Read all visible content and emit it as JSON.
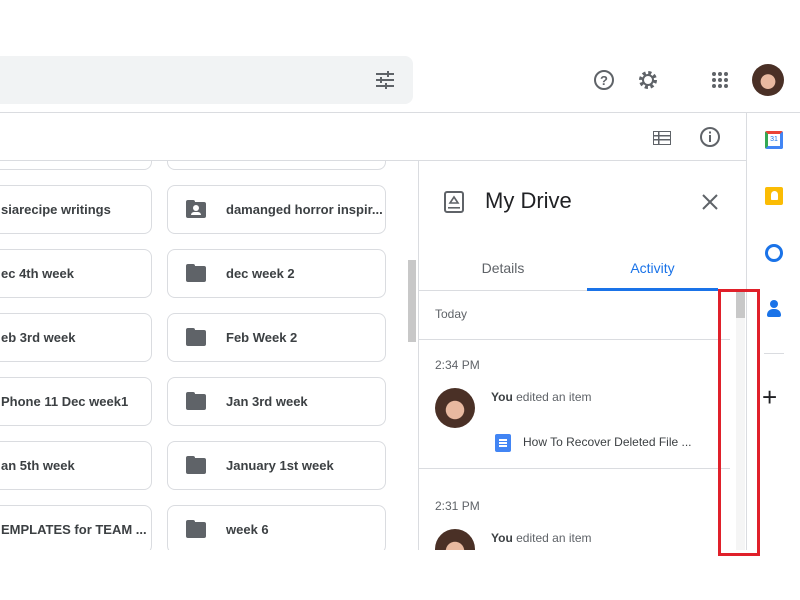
{
  "toolbar": {
    "filter_icon": "tune-icon",
    "help_icon": "help-circle-icon",
    "settings_icon": "gear-icon",
    "apps_icon": "apps-grid-icon",
    "list_view_icon": "list-view-icon",
    "info_icon": "info-icon"
  },
  "folders": {
    "left": [
      "siarecipe writings",
      "ec 4th week",
      "eb 3rd week",
      "Phone 11 Dec week1",
      "an 5th week",
      "EMPLATES for TEAM ..."
    ],
    "right": [
      {
        "name": "damanged horror inspir...",
        "icon": "shared-folder-icon"
      },
      {
        "name": "dec week 2",
        "icon": "folder-icon"
      },
      {
        "name": "Feb Week 2",
        "icon": "folder-icon"
      },
      {
        "name": "Jan 3rd week",
        "icon": "folder-icon"
      },
      {
        "name": "January 1st week",
        "icon": "folder-icon"
      },
      {
        "name": "week 6",
        "icon": "folder-icon"
      }
    ]
  },
  "panel": {
    "title": "My Drive",
    "tabs": [
      "Details",
      "Activity"
    ],
    "active_tab": "Activity",
    "section": "Today",
    "activities": [
      {
        "time": "2:34 PM",
        "actor": "You",
        "action": " edited an item",
        "file": "How To Recover Deleted File ..."
      },
      {
        "time": "2:31 PM",
        "actor": "You",
        "action": " edited an item"
      }
    ]
  },
  "side_apps": [
    "Calendar",
    "Keep",
    "Tasks",
    "Contacts"
  ],
  "accent": "#1a73e8",
  "highlight": "#e0202a"
}
